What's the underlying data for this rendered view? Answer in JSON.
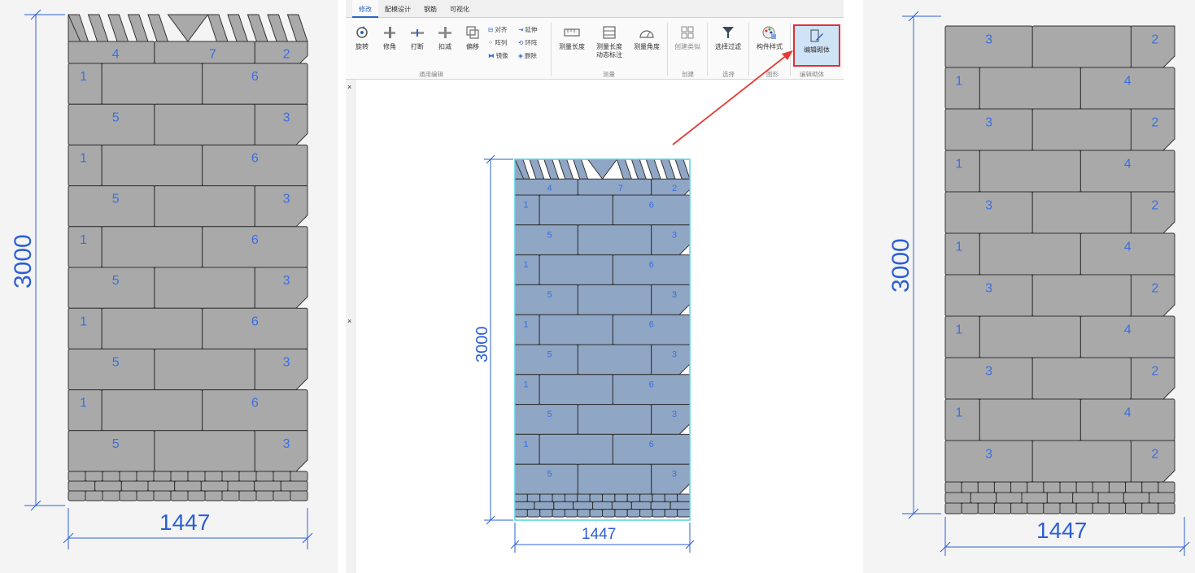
{
  "left_panel": {
    "height_dim": "3000",
    "width_dim": "1447",
    "top_labels": [
      "4",
      "7",
      "2"
    ],
    "rows": [
      {
        "left": "1",
        "right": "6"
      },
      {
        "left": "5",
        "right": "3"
      },
      {
        "left": "1",
        "right": "6"
      },
      {
        "left": "5",
        "right": "3"
      },
      {
        "left": "1",
        "right": "6"
      },
      {
        "left": "5",
        "right": "3"
      },
      {
        "left": "1",
        "right": "6"
      },
      {
        "left": "5",
        "right": "3"
      },
      {
        "left": "1",
        "right": "6"
      },
      {
        "left": "5",
        "right": "3"
      }
    ]
  },
  "ribbon": {
    "tabs": [
      "修改",
      "配模设计",
      "钢筋",
      "可视化"
    ],
    "active_tab": "修改",
    "buttons": {
      "rotate": "旋转",
      "trim": "修角",
      "break": "打断",
      "deduct": "扣减",
      "offset": "偏移",
      "measure_len": "测量长度",
      "measure_dyn_1": "测量长度",
      "measure_dyn_2": "动态标注",
      "measure_angle": "测量角度",
      "create_similar": "创建类似",
      "filter_select": "选择过滤",
      "component_style": "构件样式",
      "edit_masonry": "编辑砌体"
    },
    "small_commands": {
      "align": "对齐",
      "extend": "延伸",
      "array": "阵列",
      "ring_array": "环阵",
      "mirror": "镜像",
      "delete": "删除"
    },
    "groups": {
      "general_edit": "通用编辑",
      "measure": "测量",
      "create": "创建",
      "select": "选择",
      "graphics": "图形",
      "edit_masonry": "编辑砌体"
    }
  },
  "mid_panel": {
    "height_dim": "3000",
    "width_dim": "1447",
    "top_labels": [
      "4",
      "7",
      "2"
    ],
    "rows": [
      {
        "left": "1",
        "right": "6"
      },
      {
        "left": "5",
        "right": "3"
      },
      {
        "left": "1",
        "right": "6"
      },
      {
        "left": "5",
        "right": "3"
      },
      {
        "left": "1",
        "right": "6"
      },
      {
        "left": "5",
        "right": "3"
      },
      {
        "left": "1",
        "right": "6"
      },
      {
        "left": "5",
        "right": "3"
      },
      {
        "left": "1",
        "right": "6"
      },
      {
        "left": "5",
        "right": "3"
      }
    ]
  },
  "right_panel": {
    "height_dim": "3000",
    "width_dim": "1447",
    "rows": [
      {
        "left": "3",
        "right": "2"
      },
      {
        "left": "1",
        "right": "4"
      },
      {
        "left": "3",
        "right": "2"
      },
      {
        "left": "1",
        "right": "4"
      },
      {
        "left": "3",
        "right": "2"
      },
      {
        "left": "1",
        "right": "4"
      },
      {
        "left": "3",
        "right": "2"
      },
      {
        "left": "1",
        "right": "4"
      },
      {
        "left": "3",
        "right": "2"
      },
      {
        "left": "1",
        "right": "4"
      },
      {
        "left": "3",
        "right": "2"
      }
    ]
  },
  "colors": {
    "dimension": "#2b5fd6",
    "block_fill": "#a9a9a9",
    "block_fill_selected": "#8fa6c4",
    "selection_outline": "#4fd0e0",
    "highlight_box": "#e03030",
    "arrow": "#e53935"
  }
}
